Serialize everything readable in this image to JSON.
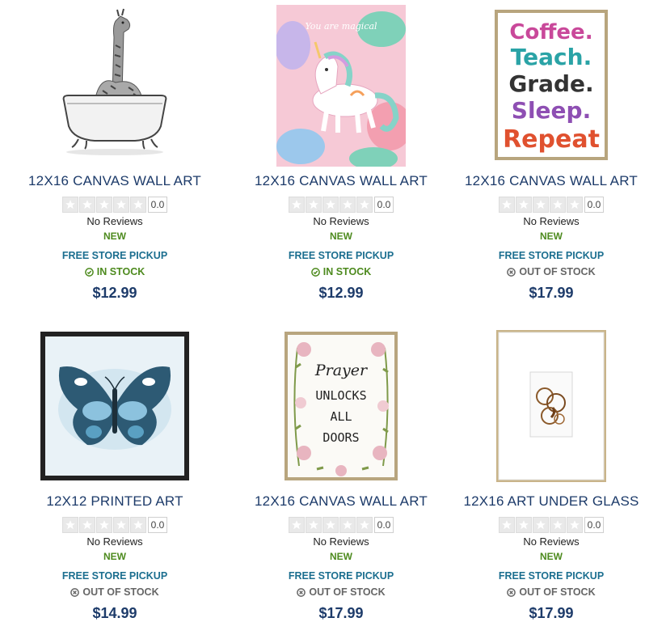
{
  "colors": {
    "title": "#1d3b6a",
    "new": "#4d8a1e",
    "pickup": "#1b6e8f",
    "in_stock": "#4d8a1e",
    "out_of_stock": "#666666",
    "price": "#1d3b6a"
  },
  "products": [
    {
      "title": "12X16 CANVAS WALL ART",
      "score": "0.0",
      "reviews": "No Reviews",
      "badge": "NEW",
      "pickup": "FREE STORE PICKUP",
      "stock": "IN STOCK",
      "stock_icon": "check-circle-icon",
      "price": "$12.99",
      "rating_stars_filled": 0,
      "image_icon": "giraffe-in-bathtub-art"
    },
    {
      "title": "12X16 CANVAS WALL ART",
      "score": "0.0",
      "reviews": "No Reviews",
      "badge": "NEW",
      "pickup": "FREE STORE PICKUP",
      "stock": "IN STOCK",
      "stock_icon": "check-circle-icon",
      "price": "$12.99",
      "rating_stars_filled": 0,
      "image_icon": "unicorn-art",
      "art_text": "You are magical"
    },
    {
      "title": "12X16 CANVAS WALL ART",
      "score": "0.0",
      "reviews": "No Reviews",
      "badge": "NEW",
      "pickup": "FREE STORE PICKUP",
      "stock": "OUT OF STOCK",
      "stock_icon": "x-circle-icon",
      "price": "$17.99",
      "rating_stars_filled": 0,
      "image_icon": "coffee-teach-art",
      "art_lines": [
        "Coffee.",
        "Teach.",
        "Grade.",
        "Sleep.",
        "Repeat"
      ]
    },
    {
      "title": "12X12 PRINTED ART",
      "score": "0.0",
      "reviews": "No Reviews",
      "badge": "NEW",
      "pickup": "FREE STORE PICKUP",
      "stock": "OUT OF STOCK",
      "stock_icon": "x-circle-icon",
      "price": "$14.99",
      "rating_stars_filled": 0,
      "image_icon": "butterfly-art"
    },
    {
      "title": "12X16 CANVAS WALL ART",
      "score": "0.0",
      "reviews": "No Reviews",
      "badge": "NEW",
      "pickup": "FREE STORE PICKUP",
      "stock": "OUT OF STOCK",
      "stock_icon": "x-circle-icon",
      "price": "$17.99",
      "rating_stars_filled": 0,
      "image_icon": "prayer-floral-art",
      "art_lines": [
        "Prayer",
        "UNLOCKS",
        "ALL",
        "DOORS"
      ]
    },
    {
      "title": "12X16 ART UNDER GLASS",
      "score": "0.0",
      "reviews": "No Reviews",
      "badge": "NEW",
      "pickup": "FREE STORE PICKUP",
      "stock": "OUT OF STOCK",
      "stock_icon": "x-circle-icon",
      "price": "$17.99",
      "rating_stars_filled": 0,
      "image_icon": "coffee-rings-art"
    }
  ]
}
